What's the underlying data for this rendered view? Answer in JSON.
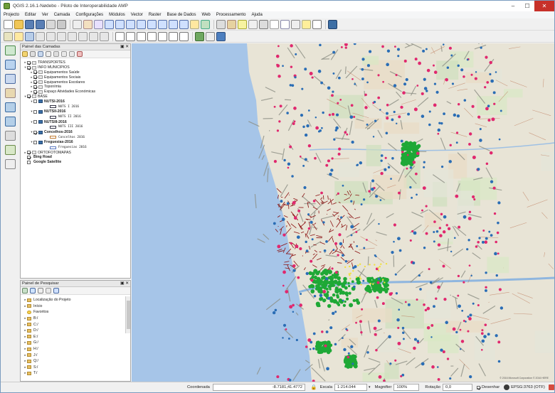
{
  "window": {
    "title": "QGIS 2.16.1-Nødebo - Piloto de Interoperabilidade AMP",
    "minimize": "–",
    "maximize": "☐",
    "close": "✕"
  },
  "menu": [
    "Projecto",
    "Editar",
    "Ver",
    "Camada",
    "Configurações",
    "Módulos",
    "Vector",
    "Raster",
    "Base de Dados",
    "Web",
    "Processamento",
    "Ajuda"
  ],
  "layers_panel": {
    "title": "Painel das Camadas",
    "buttons": "▣ ✕",
    "items": [
      {
        "label": "TRANSPORTES",
        "level": 0,
        "checked": true,
        "group": true,
        "expanded": false,
        "bold": false
      },
      {
        "label": "INFO MUNICIPIOS",
        "level": 0,
        "checked": true,
        "group": true,
        "expanded": true,
        "bold": false
      },
      {
        "label": "Equipamentos Saúde",
        "level": 1,
        "checked": true,
        "group": true,
        "expanded": false,
        "bold": false
      },
      {
        "label": "Equipamentos Sociais",
        "level": 1,
        "checked": true,
        "group": true,
        "expanded": false,
        "bold": false
      },
      {
        "label": "Equipamentos Escolares",
        "level": 1,
        "checked": true,
        "group": true,
        "expanded": false,
        "bold": false
      },
      {
        "label": "Toponímia",
        "level": 1,
        "checked": true,
        "group": true,
        "expanded": false,
        "bold": false
      },
      {
        "label": "Espaço Atividades Económicas",
        "level": 1,
        "checked": true,
        "group": true,
        "expanded": false,
        "bold": false
      },
      {
        "label": "BASE",
        "level": 0,
        "checked": true,
        "group": true,
        "expanded": true,
        "bold": false
      },
      {
        "label": "NUTSI-2016",
        "level": 1,
        "checked": false,
        "group": false,
        "expanded": true,
        "bold": true,
        "legend": "NUTS I 2016"
      },
      {
        "label": "NUTSII-2016",
        "level": 1,
        "checked": false,
        "group": false,
        "expanded": true,
        "bold": true,
        "legend": "NUTS II 2016"
      },
      {
        "label": "NUTSIII-2016",
        "level": 1,
        "checked": false,
        "group": false,
        "expanded": true,
        "bold": true,
        "legend": "NUTS III 2016"
      },
      {
        "label": "Concelhos-2016",
        "level": 1,
        "checked": true,
        "group": false,
        "expanded": true,
        "bold": true,
        "legend": "Concelhos 2016"
      },
      {
        "label": "Freguesias-2016",
        "level": 1,
        "checked": false,
        "group": false,
        "expanded": true,
        "bold": true,
        "legend": "Freguesias 2016"
      },
      {
        "label": "ORTOFOTOMAPAS",
        "level": 0,
        "checked": true,
        "group": true,
        "expanded": false,
        "bold": false
      },
      {
        "label": "Bing Road",
        "level": 0,
        "checked": true,
        "group": false,
        "expanded": false,
        "bold": true,
        "noarrow": true
      },
      {
        "label": "Google Satellite",
        "level": 0,
        "checked": false,
        "group": false,
        "expanded": false,
        "bold": true,
        "noarrow": true
      }
    ]
  },
  "browser_panel": {
    "title": "Painel de Pesquisar",
    "buttons": "▣ ✕",
    "items": [
      "Localização do Projeto",
      "Início",
      "Favoritos",
      "B:/",
      "C:/",
      "D:/",
      "E:/",
      "G:/",
      "H:/",
      "J:/",
      "Q:/",
      "S:/",
      "T:/"
    ]
  },
  "status": {
    "coord_label": "Coordenada",
    "coord_value": "-8.7181,41.4772",
    "scale_label": "Escala",
    "scale_value": "1:214.044",
    "magnifier_label": "Magnifier",
    "magnifier_value": "100%",
    "rotation_label": "Rotação",
    "rotation_value": "0,0",
    "render_label": "Desenhar",
    "crs": "EPSG:3763 (OTF)"
  },
  "map": {
    "attribution": "© 2016 Microsoft Corporation © 2016 HERE"
  },
  "colors": {
    "sea": "#a6c5e8",
    "land": "#e8e4d6",
    "accent_green": "#1ea836",
    "accent_pink": "#e0286e",
    "accent_blue": "#2a6db5",
    "boundary_red": "#8a1010"
  }
}
